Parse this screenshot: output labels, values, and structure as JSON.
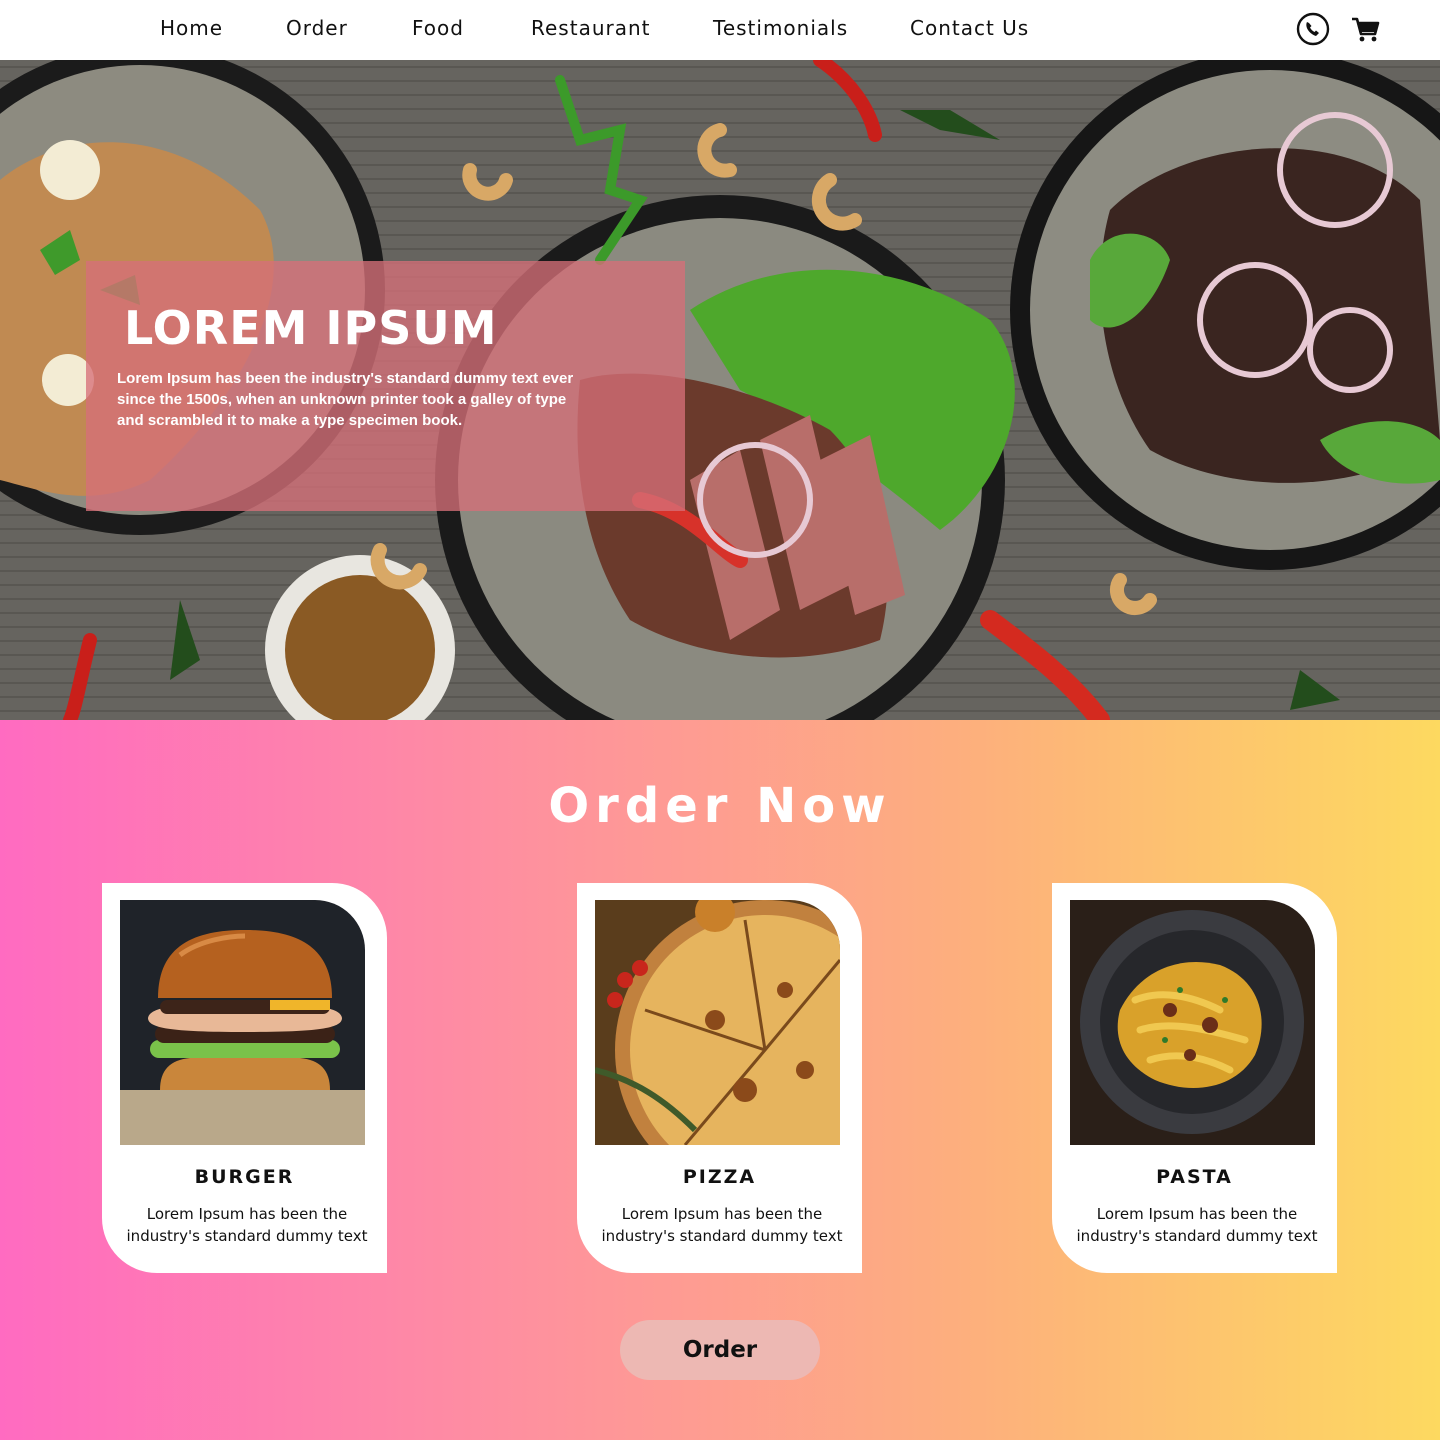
{
  "nav": {
    "links": [
      "Home",
      "Order",
      "Food",
      "Restaurant",
      "Testimonials",
      "Contact Us"
    ],
    "icons": [
      "phone-icon",
      "cart-icon"
    ]
  },
  "hero": {
    "title": "LOREM IPSUM",
    "text": "Lorem Ipsum has been the industry's standard dummy text ever since the 1500s, when an unknown printer took a galley of type and scrambled it to make a type specimen book."
  },
  "order_section": {
    "title": "Order Now",
    "cards": [
      {
        "title": "BURGER",
        "text": "Lorem Ipsum has been the industry's standard dummy text",
        "image": "burger-photo"
      },
      {
        "title": "PIZZA",
        "text": "Lorem Ipsum has been the industry's standard dummy text",
        "image": "pizza-photo"
      },
      {
        "title": "PASTA",
        "text": "Lorem Ipsum has been the industry's standard dummy text",
        "image": "pasta-photo"
      }
    ],
    "button_label": "Order"
  },
  "colors": {
    "gradient_start": "#ff6bc1",
    "gradient_end": "#fdd960",
    "hero_overlay": "#d67078",
    "order_button": "#edb8b3"
  }
}
